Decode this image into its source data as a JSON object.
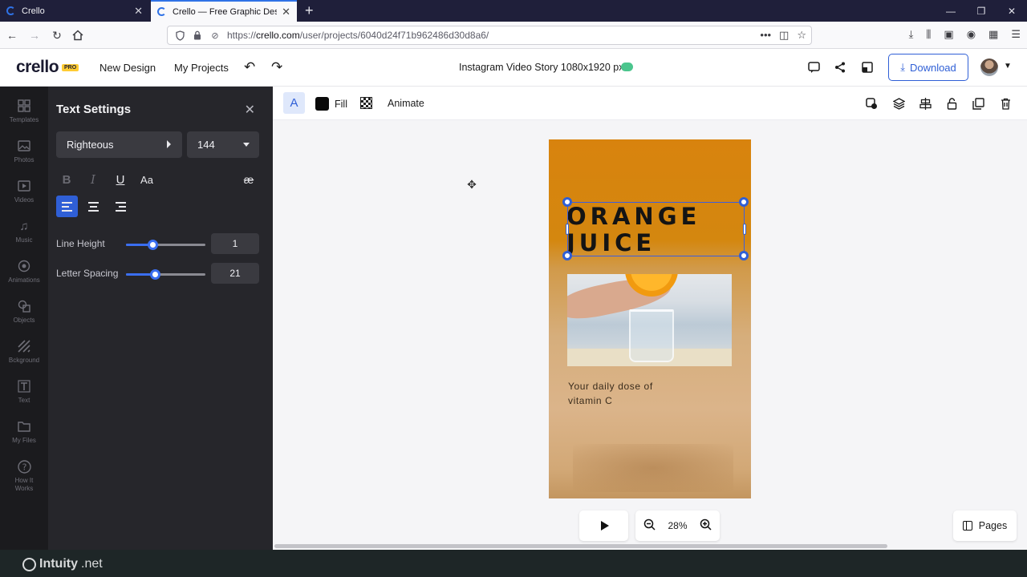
{
  "browser": {
    "tabs": [
      {
        "title": "Crello"
      },
      {
        "title": "Crello — Free Graphic Design S"
      }
    ],
    "url_prefix": "https://",
    "url_domain": "crello.com",
    "url_path": "/user/projects/6040d24f71b962486d30d8a6/"
  },
  "header": {
    "logo": "crello",
    "pro_badge": "PRO",
    "new_design": "New Design",
    "my_projects": "My Projects",
    "doc_title": "Instagram Video Story 1080x1920 px",
    "download": "Download",
    "cloud_color": "#4bc58d"
  },
  "sidebar": {
    "items": [
      {
        "label": "Templates",
        "icon": "templates-icon"
      },
      {
        "label": "Photos",
        "icon": "photos-icon"
      },
      {
        "label": "Videos",
        "icon": "videos-icon"
      },
      {
        "label": "Music",
        "icon": "music-icon"
      },
      {
        "label": "Animations",
        "icon": "animations-icon"
      },
      {
        "label": "Objects",
        "icon": "objects-icon"
      },
      {
        "label": "Bckground",
        "icon": "background-icon"
      },
      {
        "label": "Text",
        "icon": "text-icon"
      },
      {
        "label": "My Files",
        "icon": "folder-icon"
      },
      {
        "label": "How It\nWorks",
        "icon": "help-icon"
      }
    ]
  },
  "text_settings": {
    "title": "Text Settings",
    "font": "Righteous",
    "size": "144",
    "line_height_label": "Line Height",
    "line_height_value": "1",
    "line_height_level": 0.33,
    "letter_spacing_label": "Letter Spacing",
    "letter_spacing_value": "21",
    "letter_spacing_level": 0.36,
    "active_align": "left"
  },
  "toolbar": {
    "text_tool": "A",
    "fill_label": "Fill",
    "fill_color": "#0a0a0a",
    "animate_label": "Animate"
  },
  "design": {
    "headline": "ORANGE\nJUICE",
    "tagline": "Your daily dose of\nvitamin C",
    "bg_color": "#d8830e"
  },
  "controls": {
    "zoom": "28%",
    "pages": "Pages"
  },
  "watermark": {
    "brand": "Intuity",
    "suffix": ".net"
  }
}
